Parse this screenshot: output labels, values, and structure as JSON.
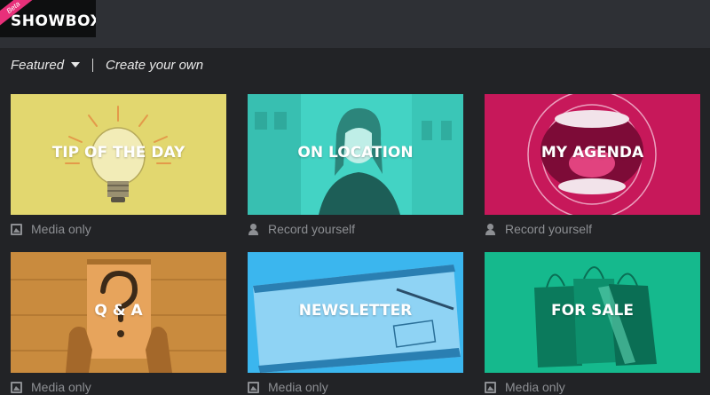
{
  "app": {
    "logo": "SHOWBOX",
    "badge": "Beta"
  },
  "nav": {
    "featured": "Featured",
    "create": "Create your own"
  },
  "colors": {
    "yellow": "#e2d76f",
    "teal": "#43d3c4",
    "magenta": "#c7185a",
    "orange": "#c98b3e",
    "blue": "#3bb6ee",
    "green": "#15b98d"
  },
  "cards": [
    {
      "title": "TIP OF THE DAY",
      "type": "Media only",
      "icon": "media-icon"
    },
    {
      "title": "ON LOCATION",
      "type": "Record yourself",
      "icon": "user-icon"
    },
    {
      "title": "MY AGENDA",
      "type": "Record yourself",
      "icon": "user-icon"
    },
    {
      "title": "Q & A",
      "type": "Media only",
      "icon": "media-icon"
    },
    {
      "title": "NEWSLETTER",
      "type": "Media only",
      "icon": "media-icon"
    },
    {
      "title": "FOR SALE",
      "type": "Media only",
      "icon": "media-icon"
    }
  ]
}
